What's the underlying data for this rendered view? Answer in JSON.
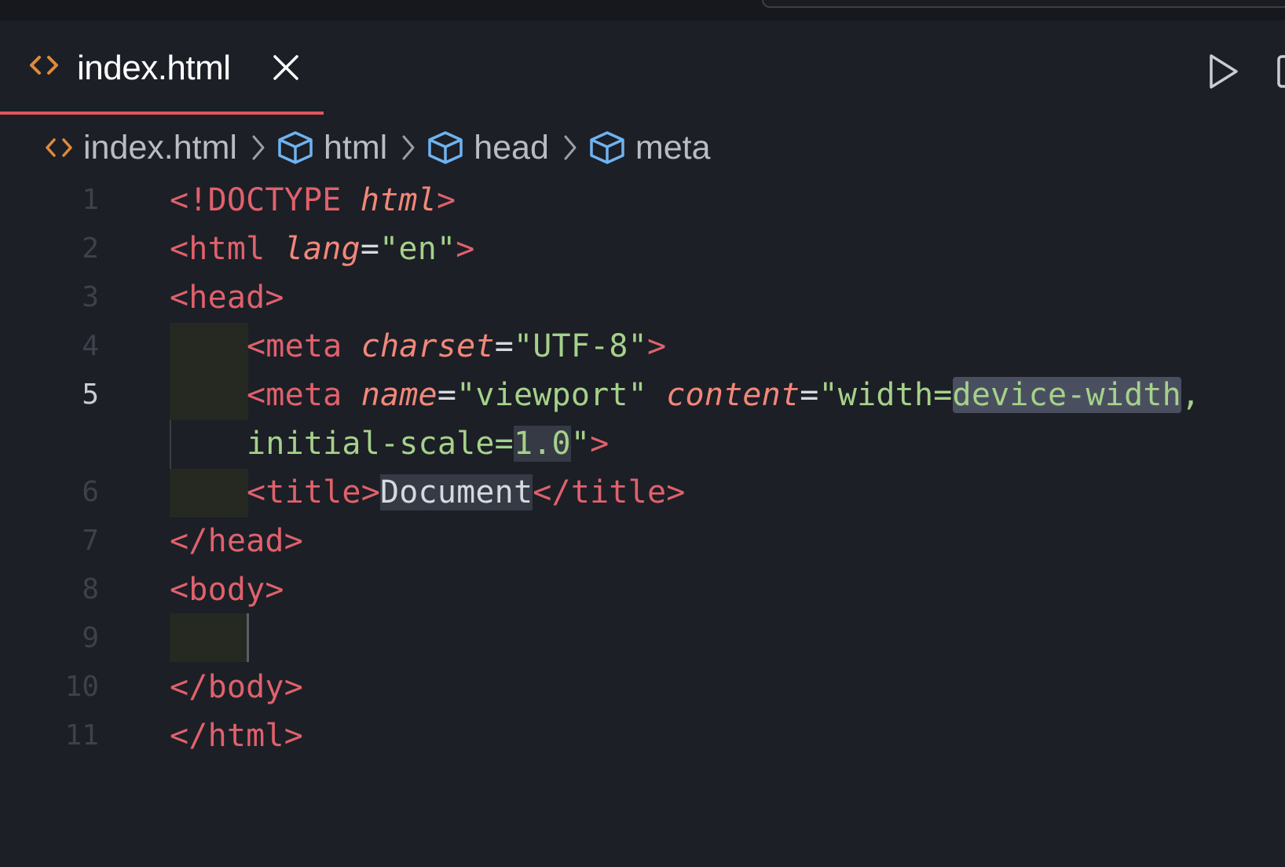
{
  "tab": {
    "label": "index.html"
  },
  "breadcrumb": {
    "file": "index.html",
    "items": [
      "html",
      "head",
      "meta"
    ]
  },
  "editor": {
    "line_numbers": [
      "1",
      "2",
      "3",
      "4",
      "5",
      "6",
      "7",
      "8",
      "9",
      "10",
      "11"
    ],
    "active_line": "5",
    "code": {
      "l1": {
        "open": "<!DOCTYPE ",
        "kw": "html",
        "close": ">"
      },
      "l2": {
        "open": "<html ",
        "attr": "lang",
        "eq": "=",
        "val": "\"en\"",
        "close": ">"
      },
      "l3": {
        "tag": "<head>"
      },
      "l4": {
        "open": "<meta ",
        "attr": "charset",
        "eq": "=",
        "val": "\"UTF-8\"",
        "close": ">"
      },
      "l5": {
        "open": "<meta ",
        "attr1": "name",
        "eq1": "=",
        "val1": "\"viewport\"",
        "sp": " ",
        "attr2": "content",
        "eq2": "=",
        "val2a": "\"width=",
        "val2b": "device-width",
        "val2c": ","
      },
      "l5b": {
        "val_a": "initial-scale=",
        "val_b": "1.0",
        "val_c": "\"",
        "close": ">"
      },
      "l6": {
        "open": "<title>",
        "text": "Document",
        "close": "</title>"
      },
      "l7": {
        "tag": "</head>"
      },
      "l8": {
        "tag": "<body>"
      },
      "l10": {
        "tag": "</body>"
      },
      "l11": {
        "tag": "</html>"
      }
    }
  },
  "icons": {
    "file": "html-file-icon",
    "element": "cube-icon",
    "separator": "chevron-right-icon",
    "close": "close-icon",
    "run": "play-icon",
    "split": "split-editor-icon"
  },
  "colors": {
    "background": "#1c1f26",
    "tab_accent": "#e0575d",
    "tag": "#e0616c",
    "attribute": "#f28779",
    "string": "#a5d18a",
    "html_icon": "#e08a3c",
    "cube_icon": "#6fb3f0"
  }
}
